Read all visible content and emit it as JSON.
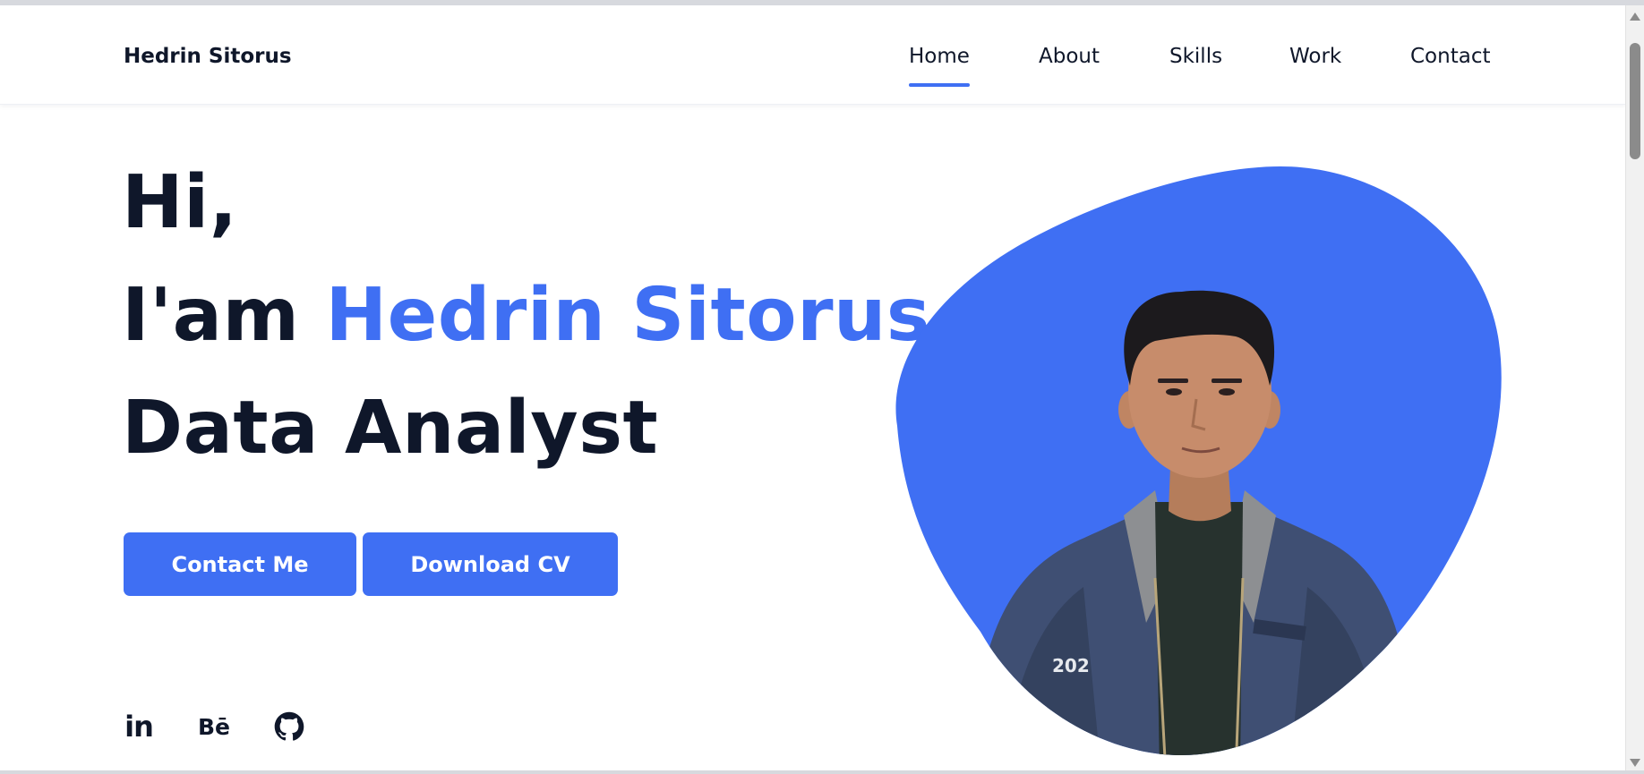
{
  "theme": {
    "accent": "#3f6ff3",
    "text": "#0f172a"
  },
  "header": {
    "brand": "Hedrin Sitorus",
    "nav": [
      {
        "label": "Home",
        "active": true
      },
      {
        "label": "About",
        "active": false
      },
      {
        "label": "Skills",
        "active": false
      },
      {
        "label": "Work",
        "active": false
      },
      {
        "label": "Contact",
        "active": false
      }
    ]
  },
  "hero": {
    "greeting": "Hi,",
    "intro_prefix": "I'am",
    "name": "Hedrin Sitorus",
    "role": "Data Analyst",
    "buttons": {
      "contact": "Contact Me",
      "download": "Download CV"
    },
    "social": [
      {
        "icon": "linkedin-icon",
        "glyph": "in"
      },
      {
        "icon": "behance-icon",
        "glyph": "Bē"
      },
      {
        "icon": "github-icon",
        "glyph": ""
      }
    ],
    "photo": {
      "jacket_text": "202"
    }
  }
}
